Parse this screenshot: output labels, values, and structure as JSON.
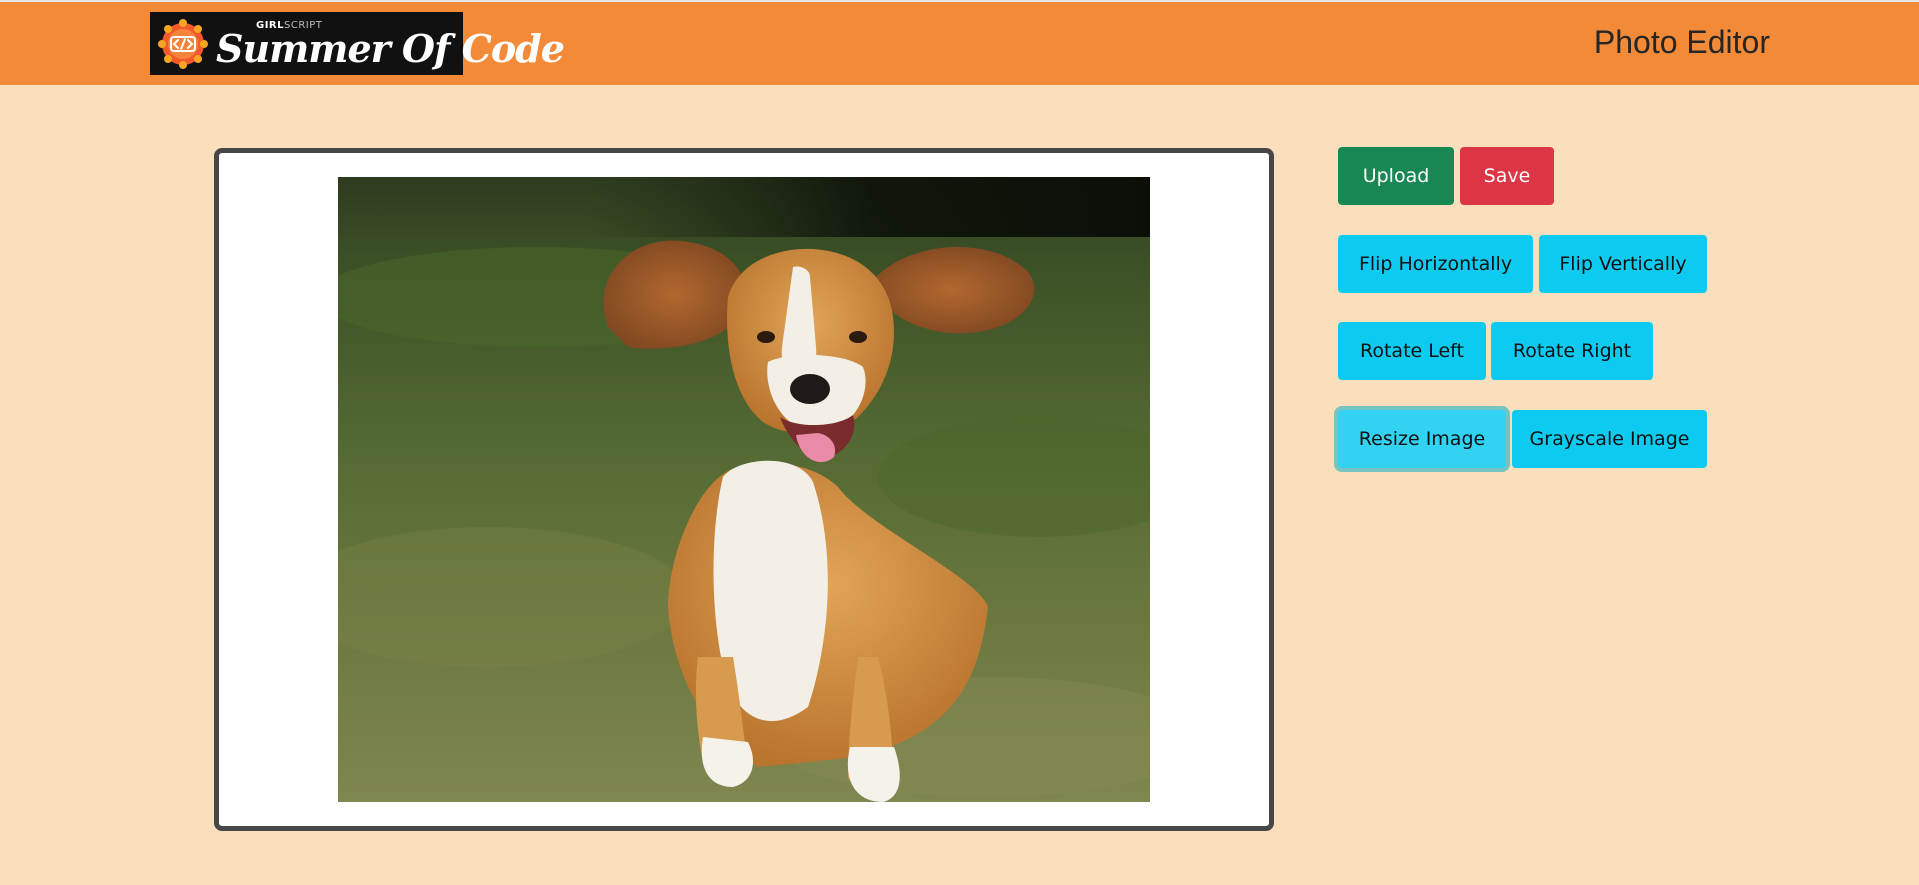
{
  "header": {
    "logo": {
      "small_text_bold": "GIRL",
      "small_text_light": "SCRIPT",
      "main_text": "Summer Of Code",
      "badge_icon": "code-brackets-icon"
    },
    "title": "Photo Editor"
  },
  "editor": {
    "image_subject": "beagle running on grass"
  },
  "toolbar": {
    "upload_label": "Upload",
    "save_label": "Save",
    "flip_h_label": "Flip Horizontally",
    "flip_v_label": "Flip Vertically",
    "rotate_left_label": "Rotate Left",
    "rotate_right_label": "Rotate Right",
    "resize_label": "Resize Image",
    "grayscale_label": "Grayscale Image"
  },
  "colors": {
    "header_bg": "#f28a38",
    "page_bg": "#f9dfbb",
    "success": "#198754",
    "danger": "#dc3545",
    "info": "#0dcaf0"
  }
}
